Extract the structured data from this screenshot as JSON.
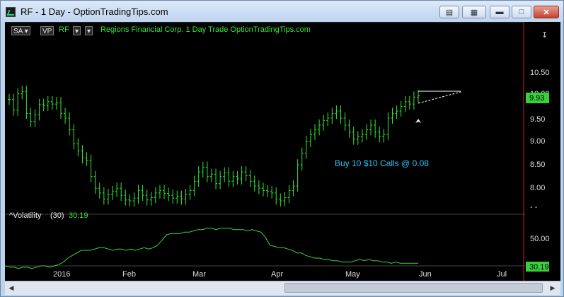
{
  "window": {
    "title": "RF - 1 Day - OptionTradingTips.com",
    "buttons": [
      "restore",
      "layout",
      "minimize",
      "maximize",
      "close"
    ]
  },
  "chart_header": {
    "study_button": "SA",
    "vp_button": "VP",
    "symbol": "RF",
    "description": "Regions Financial Corp.  1 Day  Trade  OptionTradingTips.com"
  },
  "price_axis": {
    "ticks": [
      "10.50",
      "10.00",
      "9.50",
      "9.00",
      "8.50",
      "8.00",
      "- -"
    ],
    "last_price": "9.93"
  },
  "volatility": {
    "label": "^Volatility",
    "period": "(30)",
    "value": "30.19",
    "axis_tick": "50.00",
    "last_value": "30.19"
  },
  "time_axis": {
    "labels": [
      "2016",
      "Feb",
      "Mar",
      "Apr",
      "May",
      "Jun",
      "Jul"
    ]
  },
  "annotation": "Buy 10 $10 Calls @ 0.08",
  "colors": {
    "bars": "#33e633",
    "volatility_line": "#3fd63f",
    "annotation": "#29c5f6",
    "last_price_bg": "#39d13a",
    "red_line": "#cc2222"
  },
  "chart_data": {
    "type": "bar",
    "ylim": [
      7.5,
      10.75
    ],
    "closes": [
      9.85,
      9.62,
      9.97,
      10.02,
      9.55,
      9.38,
      9.52,
      9.74,
      9.72,
      9.8,
      9.75,
      9.78,
      9.55,
      9.45,
      9.2,
      8.9,
      8.75,
      8.6,
      8.55,
      8.2,
      7.95,
      7.85,
      7.72,
      7.82,
      7.88,
      7.95,
      7.8,
      7.7,
      7.68,
      7.74,
      7.9,
      7.8,
      7.7,
      7.75,
      7.85,
      7.9,
      7.84,
      7.8,
      7.74,
      7.78,
      7.72,
      7.82,
      7.9,
      8.1,
      8.3,
      8.4,
      8.2,
      8.25,
      8.05,
      8.2,
      8.28,
      8.1,
      8.2,
      8.15,
      8.3,
      8.22,
      8.1,
      8.0,
      7.95,
      7.9,
      7.88,
      7.85,
      7.72,
      7.68,
      7.75,
      7.9,
      8.0,
      8.45,
      8.7,
      8.95,
      9.1,
      9.2,
      9.3,
      9.4,
      9.45,
      9.55,
      9.6,
      9.45,
      9.3,
      9.15,
      9.0,
      9.05,
      9.1,
      9.2,
      9.3,
      9.15,
      9.05,
      9.1,
      9.45,
      9.55,
      9.6,
      9.7,
      9.8,
      9.75,
      9.9,
      9.93
    ],
    "volatility": [
      28,
      27,
      27,
      26,
      27,
      27,
      26,
      27,
      28,
      28,
      27,
      28,
      29,
      31,
      34,
      36,
      38,
      40,
      40,
      40,
      41,
      42,
      42,
      41,
      40,
      41,
      41,
      40,
      41,
      40,
      41,
      42,
      41,
      42,
      44,
      48,
      52,
      53,
      53,
      53,
      54,
      54,
      55,
      56,
      56,
      57,
      57,
      56,
      57,
      57,
      57,
      56,
      56,
      56,
      55,
      56,
      55,
      54,
      50,
      44,
      43,
      42,
      42,
      41,
      40,
      38,
      38,
      36,
      35,
      34,
      34,
      33,
      33,
      32,
      32,
      31,
      31,
      31,
      32,
      33,
      32,
      33,
      32,
      32,
      31,
      31,
      30,
      31,
      30,
      30,
      30,
      30,
      30
    ]
  }
}
